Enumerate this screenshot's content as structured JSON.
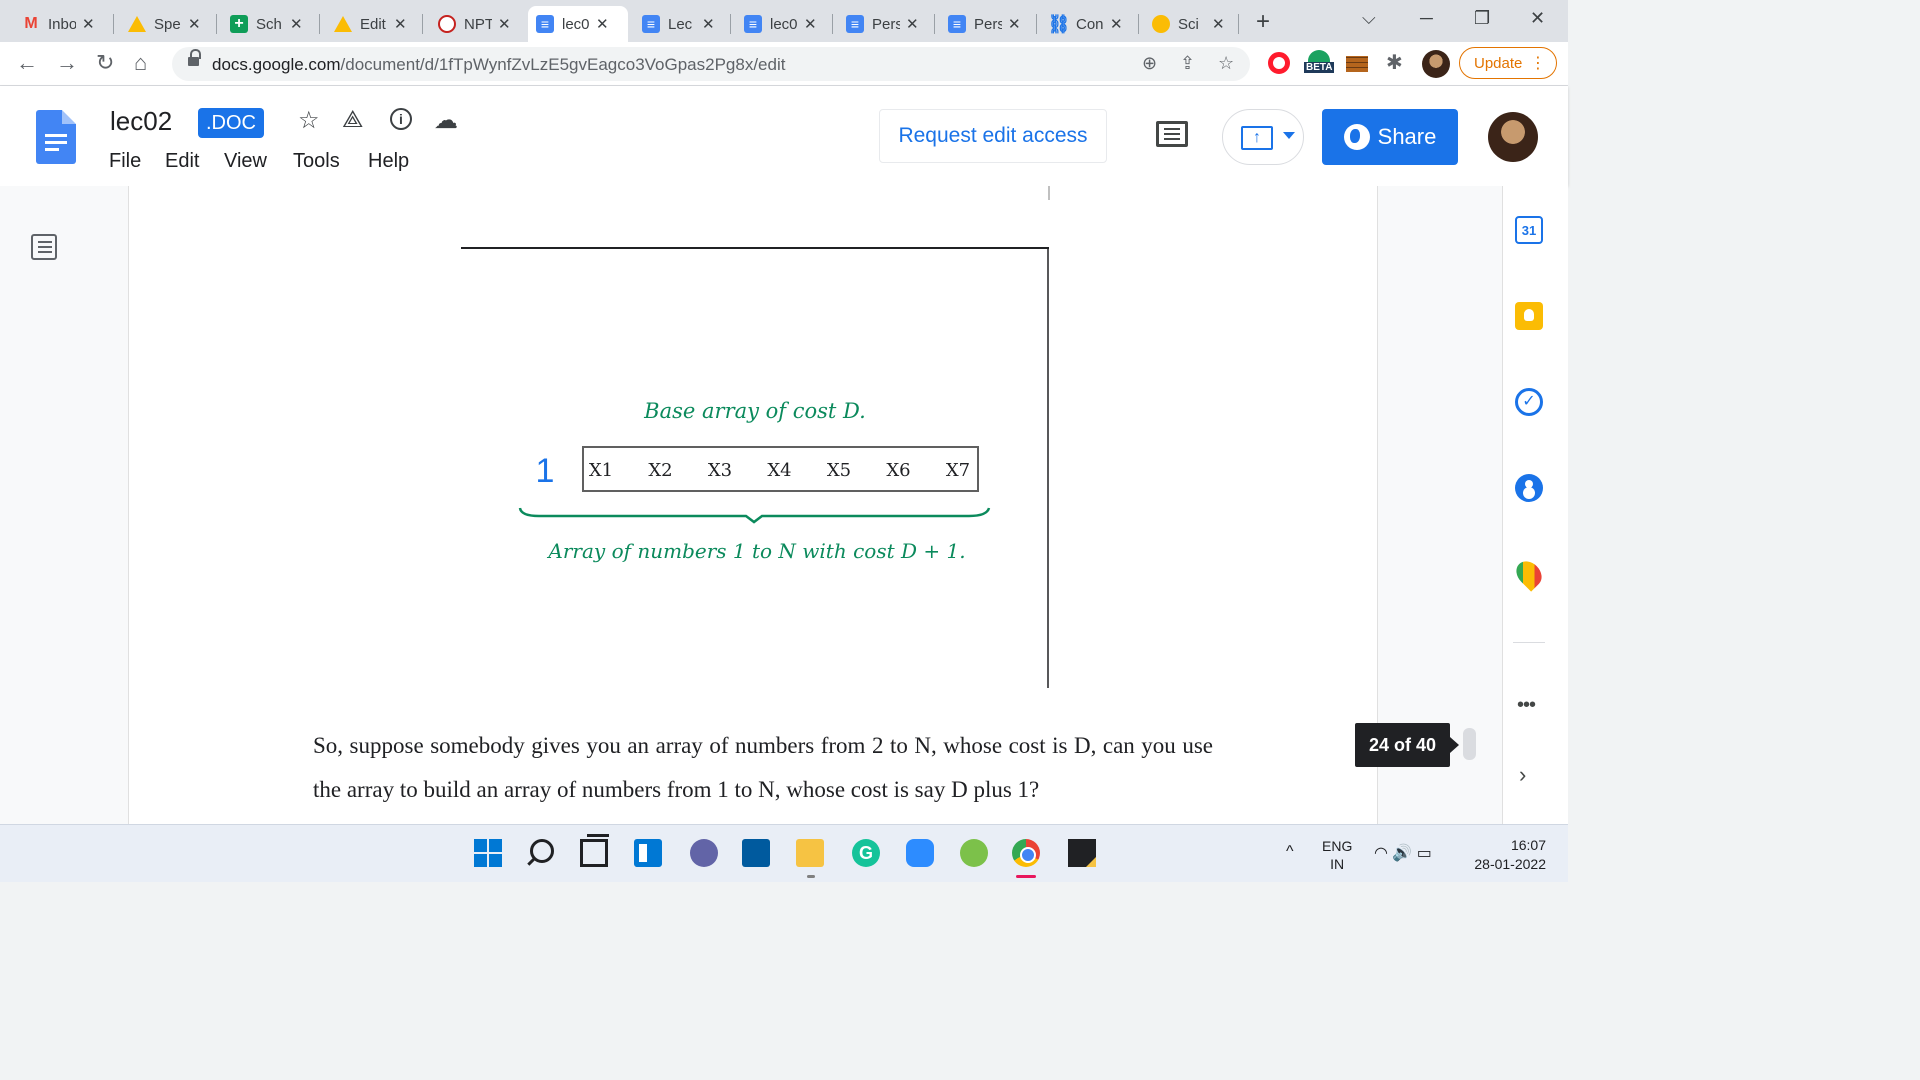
{
  "browser": {
    "tabs": [
      {
        "title": "Inbox",
        "icon": "gmail-icon",
        "active": false
      },
      {
        "title": "Spe",
        "icon": "drive-icon",
        "active": false
      },
      {
        "title": "Sch",
        "icon": "sheets-icon",
        "active": false
      },
      {
        "title": "Edit",
        "icon": "drive-icon",
        "active": false
      },
      {
        "title": "NPT",
        "icon": "nptel-icon",
        "active": false
      },
      {
        "title": "lec0",
        "icon": "docs-icon",
        "active": true
      },
      {
        "title": "Lec",
        "icon": "docs-icon",
        "active": false
      },
      {
        "title": "lec0",
        "icon": "docs-icon",
        "active": false
      },
      {
        "title": "Pers",
        "icon": "docs-icon",
        "active": false
      },
      {
        "title": "Pers",
        "icon": "docs-icon",
        "active": false
      },
      {
        "title": "Con",
        "icon": "link-icon",
        "active": false
      },
      {
        "title": "Sci",
        "icon": "sci-icon",
        "active": false
      }
    ],
    "url_host": "docs.google.com",
    "url_path": "/document/d/1fTpWynfZvLzE5gvEagco3VoGpas2Pg8x/edit",
    "update_label": "Update",
    "beta_label": "BETA"
  },
  "doc": {
    "title": "lec02",
    "badge": ".DOC",
    "menu": [
      "File",
      "Edit",
      "View",
      "Tools",
      "Help"
    ],
    "request_edit_label": "Request edit access",
    "share_label": "Share",
    "page_counter": "24 of 40"
  },
  "figure": {
    "top_label": "Base array of cost D.",
    "prefix": "1",
    "cells": [
      "X1",
      "X2",
      "X3",
      "X4",
      "X5",
      "X6",
      "X7"
    ],
    "bottom_label": "Array of numbers 1 to N with cost D + 1."
  },
  "body_text": "So, suppose somebody gives you an array of numbers from 2 to N, whose cost is D, can you use the array to build an array of numbers from 1 to N, whose cost is say D plus 1?",
  "side_panel": {
    "calendar_day": "31"
  },
  "taskbar": {
    "lang_1": "ENG",
    "lang_2": "IN",
    "time": "16:07",
    "date": "28-01-2022"
  },
  "colors": {
    "accent": "#1a73e8",
    "figure_green": "#0b8a5c",
    "figure_blue": "#1a73e8"
  }
}
